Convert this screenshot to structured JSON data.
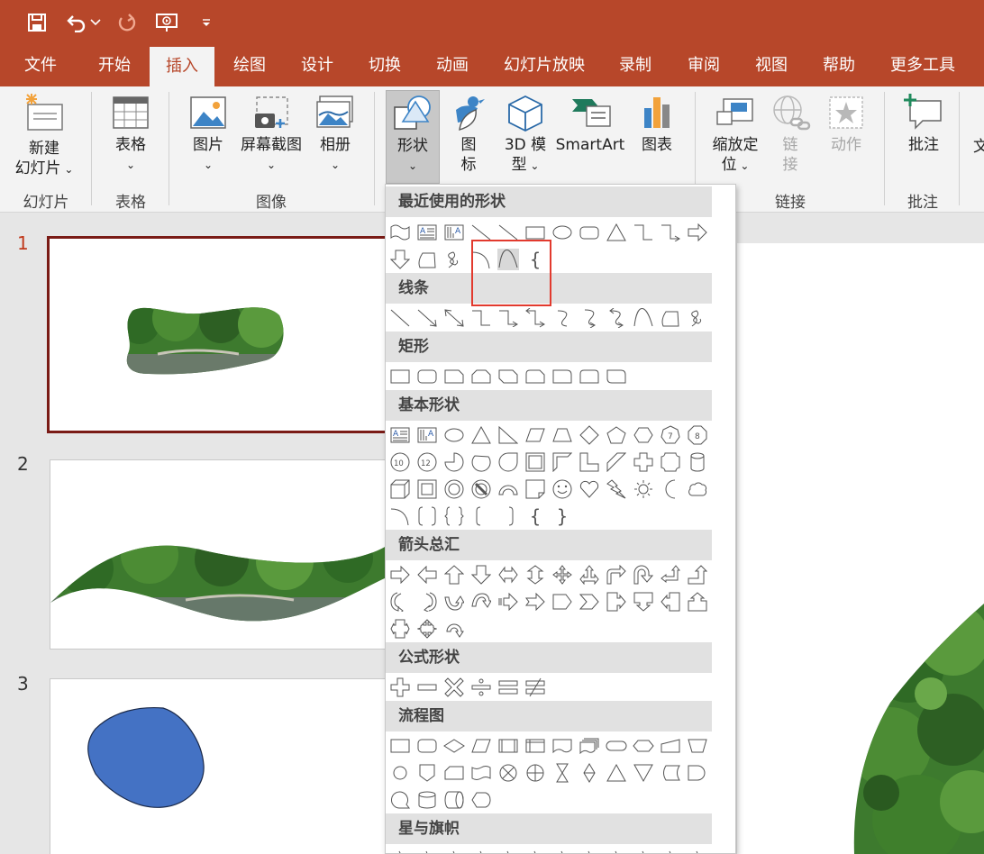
{
  "quick_access": {
    "icons": [
      "save-icon",
      "undo-icon",
      "undo-dropdown-icon",
      "redo-icon",
      "present-from-start-icon",
      "customize-qat-icon"
    ]
  },
  "tabs": [
    "文件",
    "开始",
    "插入",
    "绘图",
    "设计",
    "切换",
    "动画",
    "幻灯片放映",
    "录制",
    "审阅",
    "视图",
    "帮助",
    "更多工具"
  ],
  "active_tab": "插入",
  "ribbon": {
    "new_slide_1": "新建",
    "new_slide_2": "幻灯片",
    "table": "表格",
    "picture": "图片",
    "screenshot": "屏幕截图",
    "album": "相册",
    "shapes": "形状",
    "icons_1": "图",
    "icons_2": "标",
    "model3d_1": "3D 模",
    "model3d_2": "型",
    "smartart": "SmartArt",
    "chart": "图表",
    "zoom_1": "缩放定",
    "zoom_2": "位",
    "link_1": "链",
    "link_2": "接",
    "action": "动作",
    "comment": "批注",
    "text_partial": "文",
    "groups": {
      "slides": "幻灯片",
      "tables": "表格",
      "images": "图像",
      "links": "链接",
      "comments": "批注"
    }
  },
  "slides": [
    "1",
    "2",
    "3"
  ],
  "gallery": {
    "recent": "最近使用的形状",
    "lines": "线条",
    "rectangles": "矩形",
    "basic": "基本形状",
    "arrows": "箭头总汇",
    "equation": "公式形状",
    "flowchart": "流程图",
    "stars": "星与旗帜",
    "text_glyphs": {
      "brace": "{",
      "brace_left": "{",
      "brace_right": "}",
      "oct7": "7",
      "oct8": "8",
      "dec10": "10",
      "dodec12": "12"
    }
  },
  "colors": {
    "accent": "#b7472a",
    "highlight_box": "#e23a2e",
    "shape_fill": "#4472c4"
  }
}
